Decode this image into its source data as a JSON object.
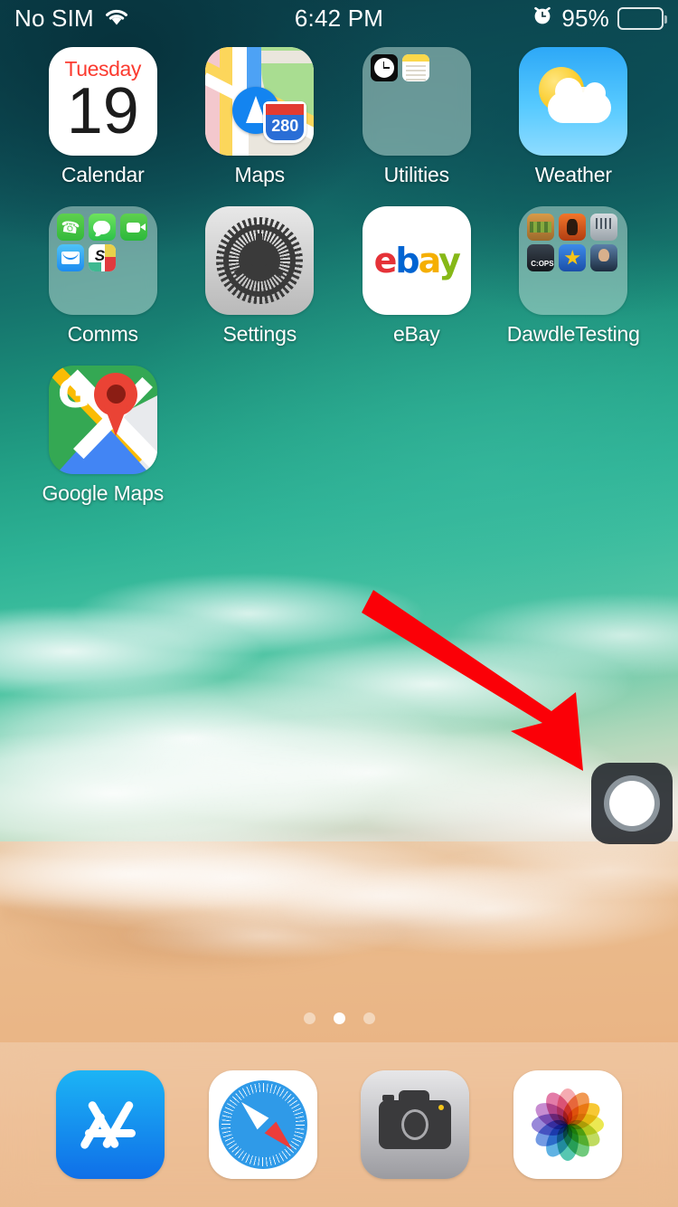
{
  "status_bar": {
    "carrier": "No SIM",
    "wifi_icon": "wifi-icon",
    "time": "6:42 PM",
    "alarm_icon": "alarm-clock-icon",
    "battery_percent": "95%",
    "battery_icon": "battery-icon",
    "battery_level": 95
  },
  "home_screen": {
    "rows": [
      [
        {
          "name": "Calendar",
          "type": "app",
          "icon": "calendar-icon",
          "calendar": {
            "weekday": "Tuesday",
            "day": "19"
          }
        },
        {
          "name": "Maps",
          "type": "app",
          "icon": "maps-icon",
          "highway": "280"
        },
        {
          "name": "Utilities",
          "type": "folder",
          "icon": "folder-utilities",
          "contents": [
            "Clock",
            "Notes"
          ]
        },
        {
          "name": "Weather",
          "type": "app",
          "icon": "weather-icon"
        }
      ],
      [
        {
          "name": "Comms",
          "type": "folder",
          "icon": "folder-comms",
          "contents": [
            "Phone",
            "Messages",
            "FaceTime",
            "Mail",
            "Slack"
          ]
        },
        {
          "name": "Settings",
          "type": "app",
          "icon": "settings-icon"
        },
        {
          "name": "eBay",
          "type": "app",
          "icon": "ebay-icon",
          "logo_text": [
            "e",
            "b",
            "a",
            "y"
          ]
        },
        {
          "name": "DawdleTesting",
          "type": "folder",
          "icon": "folder-dawdletesting",
          "contents": [
            "Game 1",
            "Game 2",
            "Game 3",
            "C:OPS",
            "Brawl Stars",
            "Game 6"
          ]
        }
      ],
      [
        {
          "name": "Google Maps",
          "type": "app",
          "icon": "google-maps-icon",
          "logo_text": "G"
        }
      ]
    ]
  },
  "page_indicator": {
    "total": 3,
    "active": 2
  },
  "dock": {
    "items": [
      {
        "name": "App Store",
        "icon": "app-store-icon"
      },
      {
        "name": "Safari",
        "icon": "safari-icon"
      },
      {
        "name": "Camera",
        "icon": "camera-icon"
      },
      {
        "name": "Photos",
        "icon": "photos-icon"
      }
    ]
  },
  "assistive_touch": {
    "name": "AssistiveTouch",
    "icon": "assistive-touch-icon"
  },
  "annotation": {
    "type": "arrow",
    "color": "#fb0007",
    "points_to": "AssistiveTouch"
  },
  "colors": {
    "accent_red": "#fb0007",
    "status_text": "#ffffff",
    "label_text": "#ffffff",
    "wallpaper_water": "#2db295",
    "wallpaper_sand": "#eab585",
    "folder_bg": "rgba(190,220,212,0.52)"
  }
}
